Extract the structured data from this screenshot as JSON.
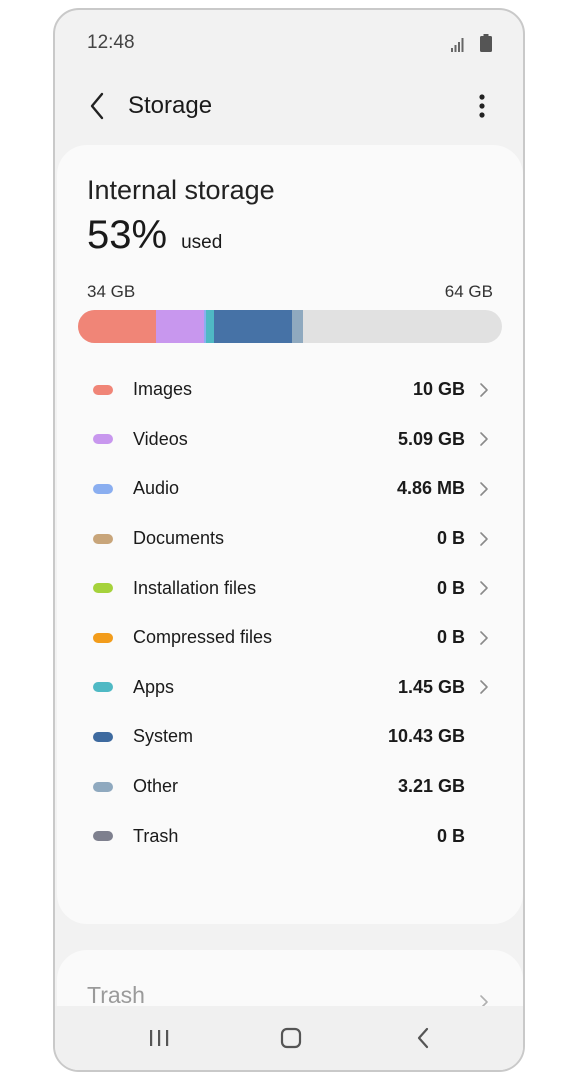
{
  "status_bar": {
    "time": "12:48"
  },
  "app_bar": {
    "title": "Storage"
  },
  "storage": {
    "heading": "Internal storage",
    "percent_used": "53%",
    "used_label": "used",
    "used_size": "34 GB",
    "total_size": "64 GB",
    "bar_segments": [
      {
        "name": "Images",
        "fraction": 0.185,
        "color": "#f08577"
      },
      {
        "name": "Videos",
        "fraction": 0.113,
        "color": "#c897ee"
      },
      {
        "name": "Audio",
        "fraction": 0.004,
        "color": "#8aaef0"
      },
      {
        "name": "Apps",
        "fraction": 0.018,
        "color": "#4fb9c4"
      },
      {
        "name": "System",
        "fraction": 0.185,
        "color": "#4672a6"
      },
      {
        "name": "Other",
        "fraction": 0.025,
        "color": "#8fa9bf"
      }
    ]
  },
  "categories": [
    {
      "label": "Images",
      "value": "10 GB",
      "color": "#f08577",
      "chevron": true
    },
    {
      "label": "Videos",
      "value": "5.09 GB",
      "color": "#c897ee",
      "chevron": true
    },
    {
      "label": "Audio",
      "value": "4.86 MB",
      "color": "#8aaef0",
      "chevron": true
    },
    {
      "label": "Documents",
      "value": "0 B",
      "color": "#c8a57a",
      "chevron": true
    },
    {
      "label": "Installation files",
      "value": "0 B",
      "color": "#a5d23b",
      "chevron": true
    },
    {
      "label": "Compressed files",
      "value": "0 B",
      "color": "#f29c1b",
      "chevron": true
    },
    {
      "label": "Apps",
      "value": "1.45 GB",
      "color": "#4fb9c4",
      "chevron": true
    },
    {
      "label": "System",
      "value": "10.43 GB",
      "color": "#3e6a9f",
      "chevron": false
    },
    {
      "label": "Other",
      "value": "3.21 GB",
      "color": "#8fa9bf",
      "chevron": false
    },
    {
      "label": "Trash",
      "value": "0 B",
      "color": "#7e808e",
      "chevron": false
    }
  ],
  "trash_card": {
    "title": "Trash"
  },
  "icons": {
    "back": "chevron-left-icon",
    "more": "more-vertical-icon",
    "signal": "signal-icon",
    "battery": "battery-icon",
    "nav_recents": "recents-icon",
    "nav_home": "home-icon",
    "nav_back": "back-icon"
  }
}
